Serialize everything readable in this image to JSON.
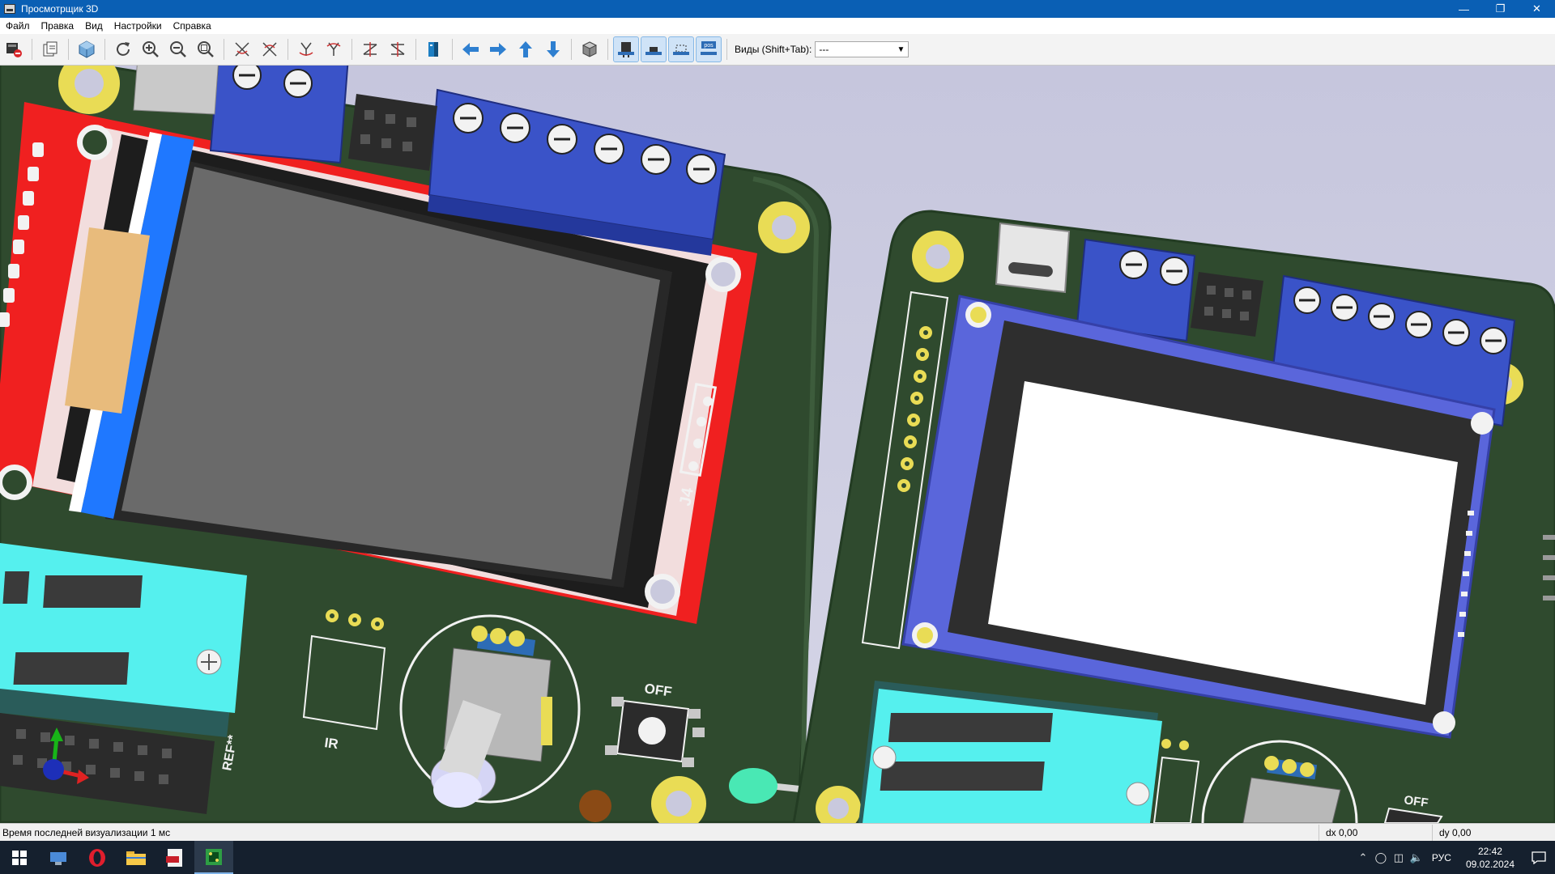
{
  "window": {
    "title": "Просмотрщик 3D",
    "controls": [
      "minimize",
      "restore",
      "close"
    ]
  },
  "menu": [
    "Файл",
    "Правка",
    "Вид",
    "Настройки",
    "Справка"
  ],
  "toolbar": {
    "views_label": "Виды (Shift+Tab):",
    "views_value": "---"
  },
  "scene": {
    "labels": {
      "connector": "J4",
      "ir": "IR",
      "off_left": "OFF",
      "off_right": "OFF",
      "ref": "REF**",
      "pos_icon": "pos"
    },
    "colors": {
      "background": "#cacadf",
      "pcb": "#2f4a2e",
      "silkscreen": "#f2f2f2",
      "pad_gold": "#e9dc55",
      "terminal_blue": "#3a53c8",
      "display_red": "#f02020",
      "display_gray": "#6a6a6a",
      "zif_cyan": "#55f0ee",
      "oled_frame": "#5a66db"
    }
  },
  "status": {
    "message": "Время последней визуализации 1 мс",
    "dx": "dx 0,00",
    "dy": "dy 0,00"
  },
  "taskbar": {
    "language": "РУС",
    "time": "22:42",
    "date": "09.02.2024"
  }
}
